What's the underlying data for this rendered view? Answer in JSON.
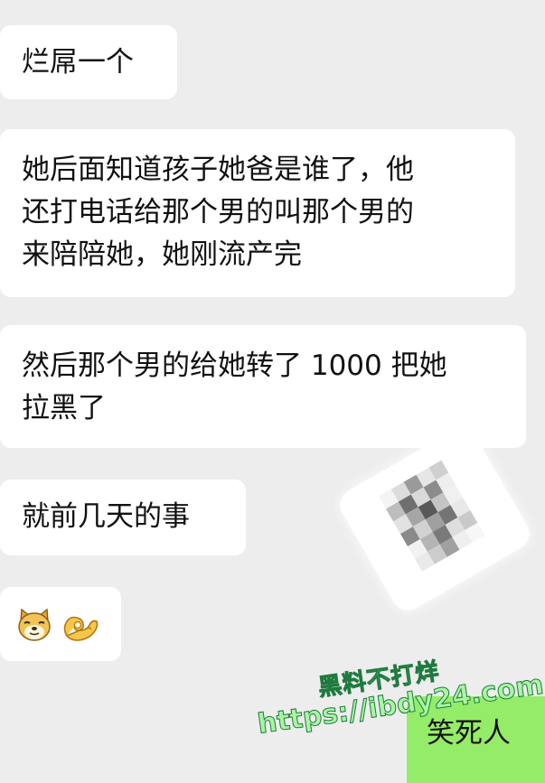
{
  "chat": {
    "messages": [
      {
        "side": "left",
        "lines": [
          "烂屌一个"
        ]
      },
      {
        "side": "left",
        "lines": [
          "她后面知道孩子她爸是谁了，他",
          "还打电话给那个男的叫那个男的",
          "来陪陪她，她刚流产完"
        ]
      },
      {
        "side": "left",
        "lines": [
          "然后那个男的给她转了 1000 把她",
          "拉黑了"
        ]
      },
      {
        "side": "left",
        "lines": [
          "就前几天的事"
        ]
      },
      {
        "side": "left",
        "emoji": [
          "dog-face-emoji",
          "ok-hand-emoji"
        ]
      },
      {
        "side": "right",
        "lines": [
          "笑死人"
        ]
      }
    ]
  },
  "overlay": {
    "blurred_sticker": "pixelated-censored-image",
    "watermark": {
      "title": "黑料不打烊",
      "url": "https://ibdy24.com"
    }
  },
  "colors": {
    "background": "#ededed",
    "incoming_bubble": "#ffffff",
    "outgoing_bubble": "#95ec69",
    "text": "#111111",
    "watermark_fill": "#9ef0a0",
    "watermark_stroke": "#1e7a3e"
  }
}
